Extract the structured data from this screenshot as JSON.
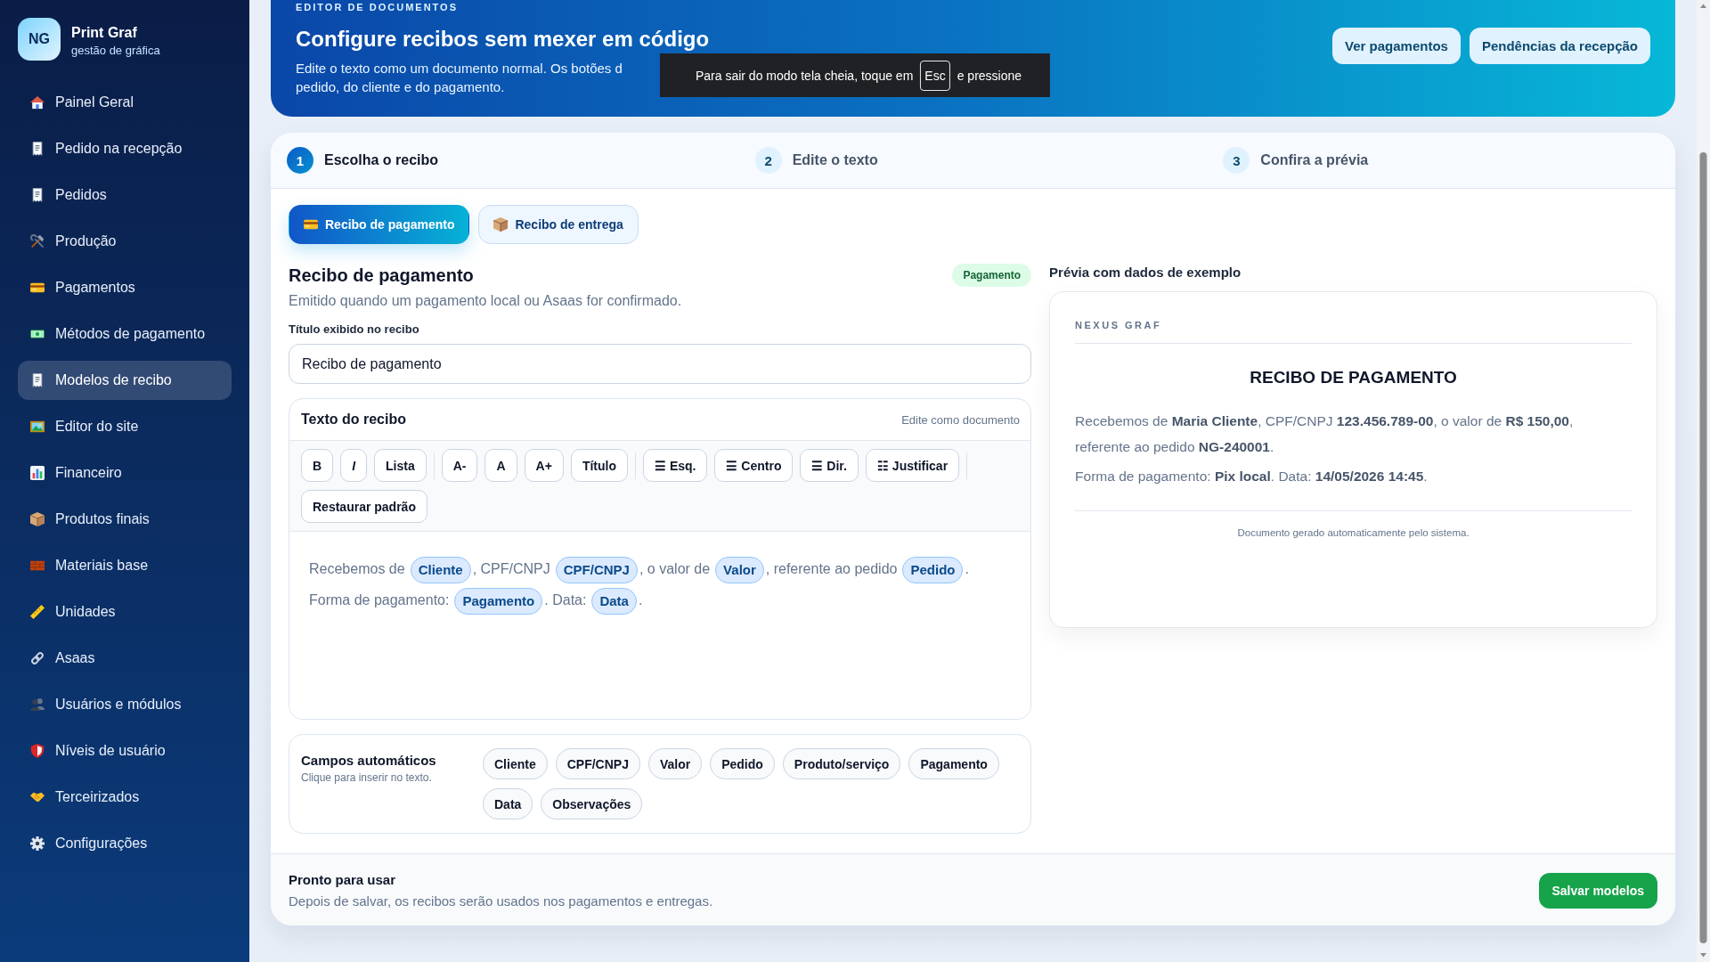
{
  "sidebar": {
    "logo": {
      "initials": "NG",
      "name": "Print Graf",
      "tagline": "gestão de gráfica"
    },
    "items": [
      {
        "label": "Painel Geral",
        "selected": false
      },
      {
        "label": "Pedido na recepção",
        "selected": false
      },
      {
        "label": "Pedidos",
        "selected": false
      },
      {
        "label": "Produção",
        "selected": false
      },
      {
        "label": "Pagamentos",
        "selected": false
      },
      {
        "label": "Métodos de pagamento",
        "selected": false
      },
      {
        "label": "Modelos de recibo",
        "selected": true
      },
      {
        "label": "Editor do site",
        "selected": false
      },
      {
        "label": "Financeiro",
        "selected": false
      },
      {
        "label": "Produtos finais",
        "selected": false
      },
      {
        "label": "Materiais base",
        "selected": false
      },
      {
        "label": "Unidades",
        "selected": false
      },
      {
        "label": "Asaas",
        "selected": false
      },
      {
        "label": "Usuários e módulos",
        "selected": false
      },
      {
        "label": "Níveis de usuário",
        "selected": false
      },
      {
        "label": "Terceirizados",
        "selected": false
      },
      {
        "label": "Configurações",
        "selected": false
      }
    ]
  },
  "header": {
    "eyebrow": "EDITOR DE DOCUMENTOS",
    "title": "Configure recibos sem mexer em código",
    "description_lines": [
      "Edite o texto como um documento normal. Os botões d",
      "pedido, do cliente e do pagamento."
    ],
    "buttons": [
      "Ver pagamentos",
      "Pendências da recepção"
    ]
  },
  "fullscreen_notice": {
    "text_before": "Para sair do modo tela cheia, toque em",
    "key": "Esc",
    "text_after": "e pressione"
  },
  "steps": [
    {
      "number": "1",
      "label": "Escolha o recibo",
      "selected": true
    },
    {
      "number": "2",
      "label": "Edite o texto",
      "selected": false
    },
    {
      "number": "3",
      "label": "Confira a prévia",
      "selected": false
    }
  ],
  "receipt_tabs": [
    {
      "label": "Recibo de pagamento",
      "selected": true
    },
    {
      "label": "Recibo de entrega",
      "selected": false
    }
  ],
  "editor": {
    "title": "Recibo de pagamento",
    "badge": "Pagamento",
    "description": "Emitido quando um pagamento local ou Asaas for confirmado.",
    "title_field": {
      "label": "Título exibido no recibo",
      "value": "Recibo de pagamento"
    },
    "text_panel": {
      "title": "Texto do recibo",
      "hint": "Edite como documento",
      "toolbar": [
        {
          "buttons": [
            {
              "label": "B",
              "italic": false
            },
            {
              "label": "I",
              "italic": true
            },
            {
              "label": "Lista",
              "italic": false
            }
          ]
        },
        {
          "buttons": [
            {
              "label": "A-",
              "italic": false
            },
            {
              "label": "A",
              "italic": false
            },
            {
              "label": "A+",
              "italic": false
            },
            {
              "label": "Título",
              "italic": false
            }
          ]
        },
        {
          "buttons": [
            {
              "label": "☰ Esq.",
              "italic": false
            },
            {
              "label": "☰ Centro",
              "italic": false
            },
            {
              "label": "☰ Dir.",
              "italic": false
            },
            {
              "label": "☷ Justificar",
              "italic": false
            }
          ]
        },
        {
          "buttons": [
            {
              "label": "Restaurar padrão",
              "italic": false
            }
          ]
        }
      ],
      "paragraphs": [
        [
          {
            "kind": "text",
            "text": "Recebemos de"
          },
          {
            "kind": "field",
            "text": "Cliente"
          },
          {
            "kind": "text",
            "text": ", CPF/CNPJ"
          },
          {
            "kind": "field",
            "text": "CPF/CNPJ"
          },
          {
            "kind": "text",
            "text": ", o valor de"
          },
          {
            "kind": "field",
            "text": "Valor"
          },
          {
            "kind": "text",
            "text": ", referente ao pedido"
          },
          {
            "kind": "field",
            "text": "Pedido"
          },
          {
            "kind": "text",
            "text": "."
          }
        ],
        [
          {
            "kind": "text",
            "text": "Forma de pagamento:"
          },
          {
            "kind": "field",
            "text": "Pagamento"
          },
          {
            "kind": "text",
            "text": ". Data:"
          },
          {
            "kind": "field",
            "text": "Data"
          },
          {
            "kind": "text",
            "text": "."
          }
        ]
      ]
    },
    "auto_fields": {
      "title": "Campos automáticos",
      "hint": "Clique para inserir no texto.",
      "fields": [
        "Cliente",
        "CPF/CNPJ",
        "Valor",
        "Pedido",
        "Produto/serviço",
        "Pagamento",
        "Data",
        "Observações"
      ]
    }
  },
  "preview": {
    "title": "Prévia com dados de exemplo",
    "company": "NEXUS GRAF",
    "heading": "RECIBO DE PAGAMENTO",
    "paragraphs": [
      "Recebemos de **Maria Cliente**, CPF/CNPJ **123.456.789-00**, o valor de **R$ 150,00**, referente ao pedido **NG-240001**.",
      "Forma de pagamento: **Pix local**. Data: **14/05/2026 14:45**."
    ],
    "footer_note": "Documento gerado automaticamente pelo sistema."
  },
  "footer": {
    "title": "Pronto para usar",
    "description": "Depois de salvar, os recibos serão usados nos pagamentos e entregas.",
    "save_button": "Salvar modelos"
  }
}
